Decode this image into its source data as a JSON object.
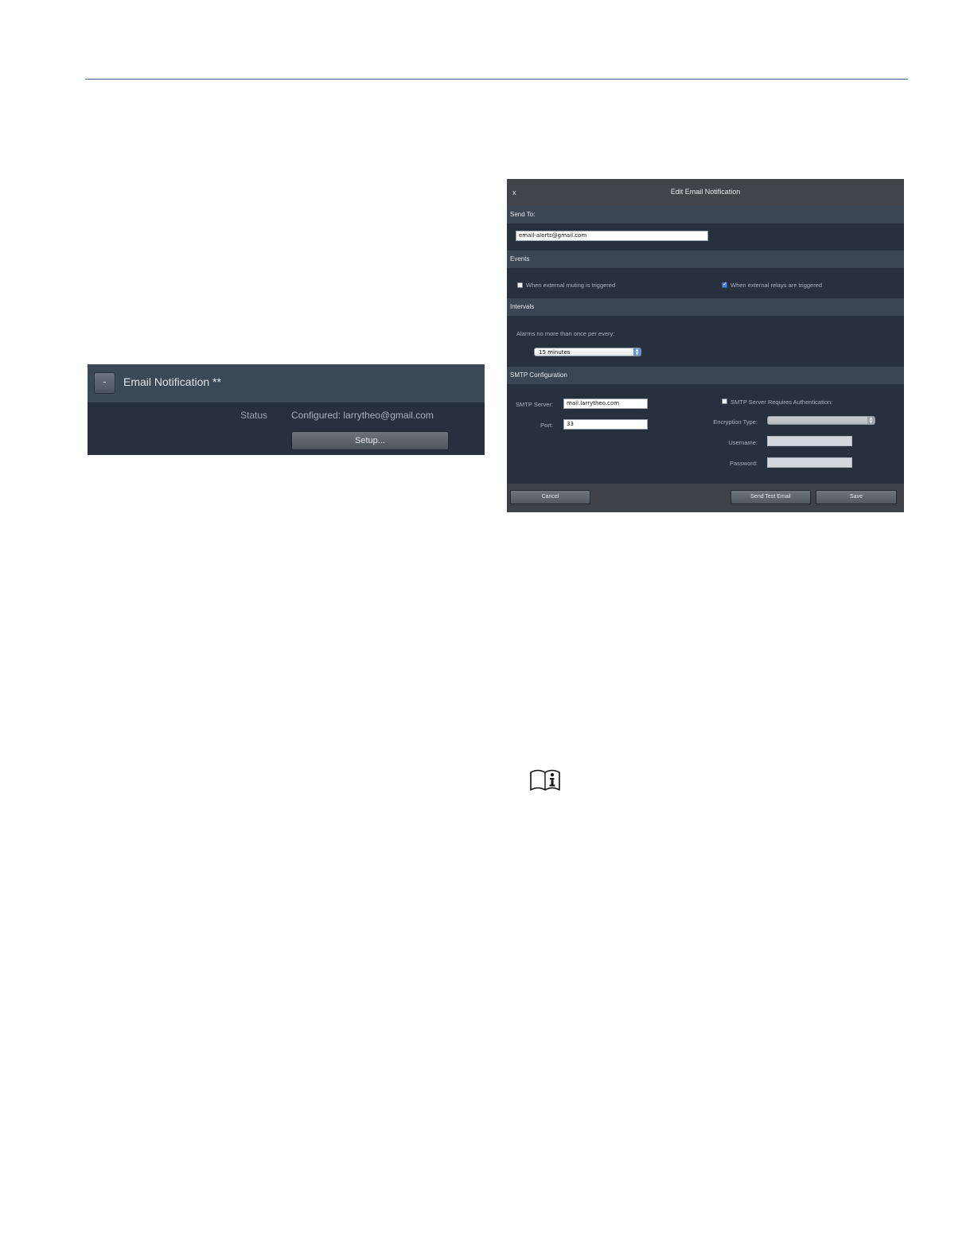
{
  "email_panel": {
    "collapse_glyph": "-",
    "title": "Email Notification **",
    "status_label": "Status",
    "status_value": "Configured: larrytheo@gmail.com",
    "setup_label": "Setup..."
  },
  "dialog": {
    "close_glyph": "x",
    "title": "Edit Email Notification",
    "send_to": {
      "heading": "Send To:",
      "email_value": "email-alerts@gmail.com"
    },
    "events": {
      "heading": "Events",
      "muting_label": "When external muting is triggered",
      "muting_checked": false,
      "relays_label": "When external relays are triggered",
      "relays_checked": true
    },
    "intervals": {
      "heading": "Intervals",
      "prompt": "Alarms no more than once per every:",
      "selected": "15 minutes"
    },
    "smtp": {
      "heading": "SMTP Configuration",
      "server_label": "SMTP Server:",
      "server_value": "mail.larrytheo.com",
      "port_label": "Port:",
      "port_value": "33",
      "auth_label": "SMTP Server Requires Authentication:",
      "auth_checked": false,
      "encryption_label": "Encryption Type:",
      "encryption_value": "",
      "username_label": "Username:",
      "username_value": "",
      "password_label": "Password:",
      "password_value": ""
    },
    "buttons": {
      "cancel": "Cancel",
      "test": "Send Test Email",
      "save": "Save"
    }
  },
  "icons": {
    "info_manual": "book-info-icon"
  }
}
